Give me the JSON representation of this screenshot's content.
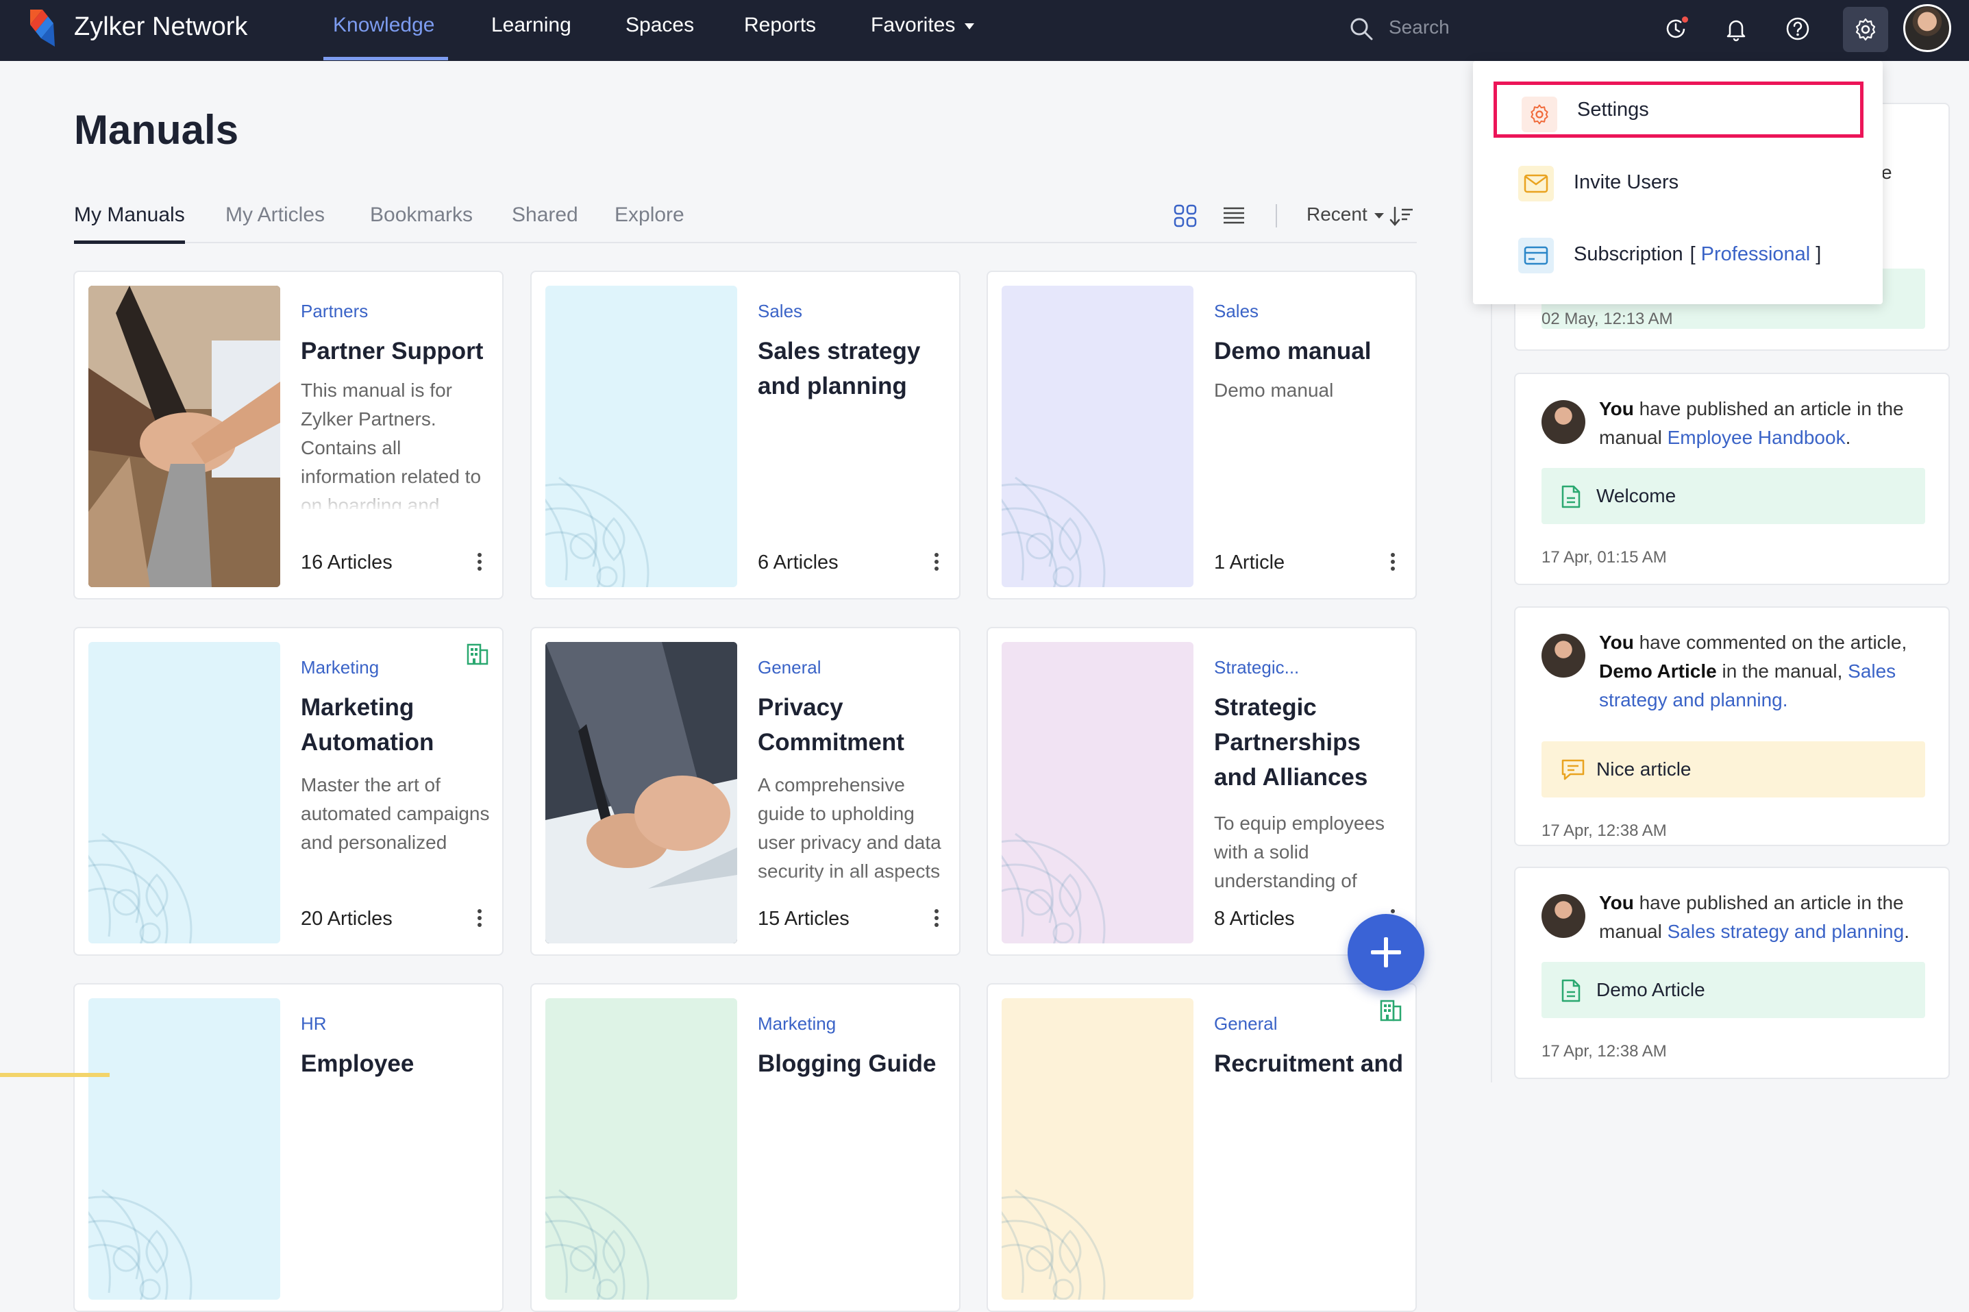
{
  "topbar": {
    "brand": "Zylker Network",
    "nav": [
      "Knowledge",
      "Learning",
      "Spaces",
      "Reports",
      "Favorites"
    ],
    "search_placeholder": "Search",
    "icons": [
      "history-icon",
      "bell-icon",
      "help-icon",
      "gear-icon"
    ]
  },
  "page": {
    "title": "Manuals",
    "tabs": [
      "My Manuals",
      "My Articles",
      "Bookmarks",
      "Shared",
      "Explore"
    ],
    "sort_label": "Recent"
  },
  "cards": [
    {
      "category": "Partners",
      "title": "Partner Support",
      "desc": "This manual is for Zylker Partners. Contains all information related to on boarding and",
      "count": "16 Articles",
      "image": "photo-hands",
      "bg": "#8b6b4e"
    },
    {
      "category": "Sales",
      "title": "Sales strategy and planning",
      "desc": "",
      "count": "6 Articles",
      "image": "pattern",
      "bg": "#dff4fb"
    },
    {
      "category": "Sales",
      "title": "Demo manual",
      "desc": "Demo manual",
      "count": "1 Article",
      "image": "pattern",
      "bg": "#e6e7fb"
    },
    {
      "category": "Marketing",
      "title": "Marketing Automation",
      "desc": "Master the art of automated campaigns and personalized",
      "count": "20 Articles",
      "image": "pattern",
      "bg": "#dff4fb",
      "building": true
    },
    {
      "category": "General",
      "title": "Privacy Commitment",
      "desc": "A comprehensive guide to upholding user privacy and data security in all aspects",
      "count": "15 Articles",
      "image": "photo-pen",
      "bg": "#4a5260"
    },
    {
      "category": "Strategic...",
      "title": "Strategic Partnerships and Alliances",
      "desc": "To equip employees with a solid understanding of",
      "count": "8 Articles",
      "image": "pattern",
      "bg": "#f1e3f3"
    },
    {
      "category": "HR",
      "title": "Employee",
      "desc": "",
      "count": "",
      "image": "pattern",
      "bg": "#dff4fb"
    },
    {
      "category": "Marketing",
      "title": "Blogging Guide",
      "desc": "",
      "count": "",
      "image": "pattern",
      "bg": "#def3e6"
    },
    {
      "category": "General",
      "title": "Recruitment and",
      "desc": "",
      "count": "",
      "image": "pattern",
      "bg": "#fdf2d8",
      "building": true
    }
  ],
  "activity": {
    "partial_text": "e",
    "first_time": "02 May, 12:13 AM",
    "items": [
      {
        "who": "You",
        "text1": " have published an article in the manual ",
        "link": "Employee Handbook",
        "text2": ".",
        "box": "Welcome",
        "box_type": "doc",
        "time": "17 Apr, 01:15 AM"
      },
      {
        "who": "You",
        "text1": " have commented on the article, ",
        "bold2": "Demo Article",
        "text3": " in the manual, ",
        "link": "Sales strategy and planning.",
        "box": "Nice article",
        "box_type": "comment",
        "time": "17 Apr, 12:38 AM"
      },
      {
        "who": "You",
        "text1": " have published an article in the manual ",
        "link": "Sales strategy and planning",
        "text2": ".",
        "box": "Demo Article",
        "box_type": "doc",
        "time": "17 Apr, 12:38 AM"
      }
    ]
  },
  "dropdown": {
    "settings": "Settings",
    "invite": "Invite Users",
    "subscription": "Subscription",
    "bracket_open": "[",
    "plan": "Professional",
    "bracket_close": "]"
  },
  "colors": {
    "accent": "#3a63d6",
    "topbar": "#1d2232",
    "highlight": "#ec1558"
  }
}
